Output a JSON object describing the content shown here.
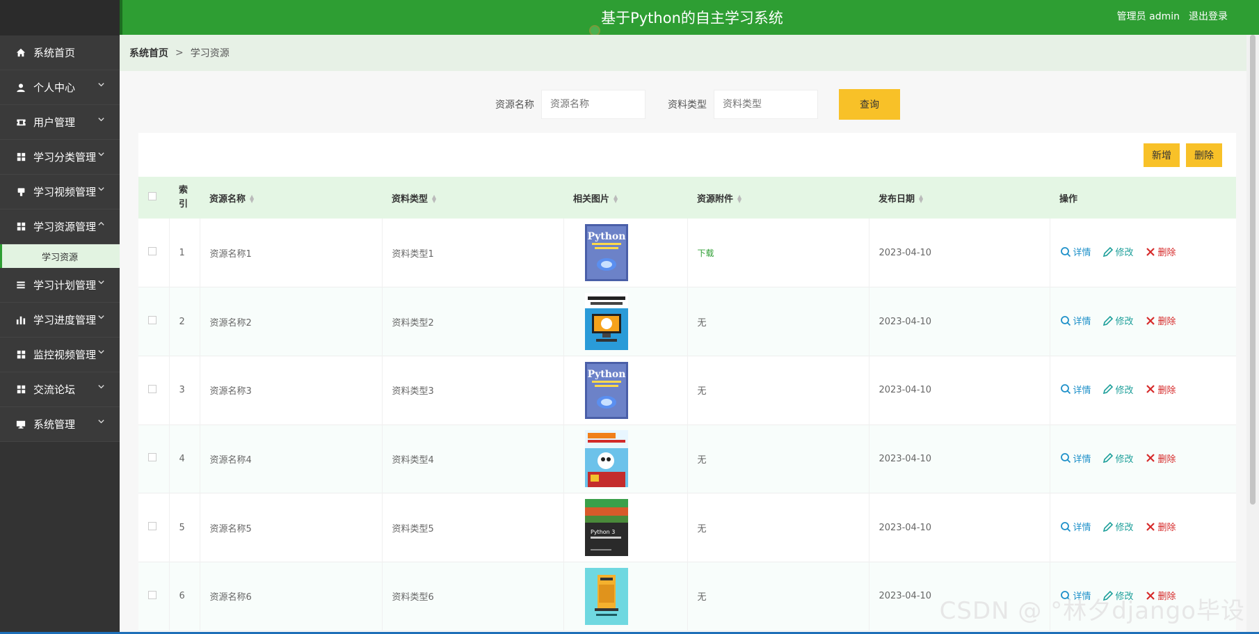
{
  "header": {
    "title": "基于Python的自主学习系统",
    "admin": "管理员 admin",
    "logout": "退出登录"
  },
  "sidebar": {
    "items": [
      {
        "label": "系统首页",
        "icon": "home-icon",
        "has_chevron": false
      },
      {
        "label": "个人中心",
        "icon": "user-icon",
        "has_chevron": true
      },
      {
        "label": "用户管理",
        "icon": "ticket-icon",
        "has_chevron": true
      },
      {
        "label": "学习分类管理",
        "icon": "grid-icon",
        "has_chevron": true
      },
      {
        "label": "学习视频管理",
        "icon": "flag-icon",
        "has_chevron": true
      },
      {
        "label": "学习资源管理",
        "icon": "grid-icon",
        "has_chevron": true,
        "expanded": true
      },
      {
        "label": "学习计划管理",
        "icon": "list-icon",
        "has_chevron": true
      },
      {
        "label": "学习进度管理",
        "icon": "bar-chart-icon",
        "has_chevron": true
      },
      {
        "label": "监控视频管理",
        "icon": "grid-icon",
        "has_chevron": true
      },
      {
        "label": "交流论坛",
        "icon": "grid-icon",
        "has_chevron": true
      },
      {
        "label": "系统管理",
        "icon": "monitor-icon",
        "has_chevron": true
      }
    ],
    "submenu": {
      "label": "学习资源"
    }
  },
  "breadcrumb": {
    "home": "系统首页",
    "sep": ">",
    "current": "学习资源"
  },
  "search": {
    "name_label": "资源名称",
    "name_placeholder": "资源名称",
    "type_label": "资料类型",
    "type_placeholder": "资料类型",
    "query_label": "查询"
  },
  "toolbar": {
    "add": "新增",
    "delete": "删除"
  },
  "table": {
    "headers": {
      "index": "索引",
      "name": "资源名称",
      "type": "资料类型",
      "image": "相关图片",
      "attachment": "资源附件",
      "date": "发布日期",
      "ops": "操作"
    },
    "ops": {
      "detail": "详情",
      "edit": "修改",
      "delete": "删除"
    },
    "rows": [
      {
        "index": "1",
        "name": "资源名称1",
        "type": "资料类型1",
        "attachment": "下载",
        "date": "2023-04-10",
        "cover": "python-blue"
      },
      {
        "index": "2",
        "name": "资源名称2",
        "type": "资料类型2",
        "attachment": "无",
        "date": "2023-04-10",
        "cover": "javascript-kids"
      },
      {
        "index": "3",
        "name": "资源名称3",
        "type": "资料类型3",
        "attachment": "无",
        "date": "2023-04-10",
        "cover": "python-blue"
      },
      {
        "index": "4",
        "name": "资源名称4",
        "type": "资料类型4",
        "attachment": "无",
        "date": "2023-04-10",
        "cover": "python-cartoon"
      },
      {
        "index": "5",
        "name": "资源名称5",
        "type": "资料类型5",
        "attachment": "无",
        "date": "2023-04-10",
        "cover": "python3-landscape"
      },
      {
        "index": "6",
        "name": "资源名称6",
        "type": "资料类型6",
        "attachment": "无",
        "date": "2023-04-10",
        "cover": "teal-book"
      }
    ]
  },
  "watermark": "CSDN @ °林夕django毕设",
  "colors": {
    "header": "#2e9e33",
    "accent_yellow": "#f8c128",
    "sidebar": "#3a3a3a"
  }
}
